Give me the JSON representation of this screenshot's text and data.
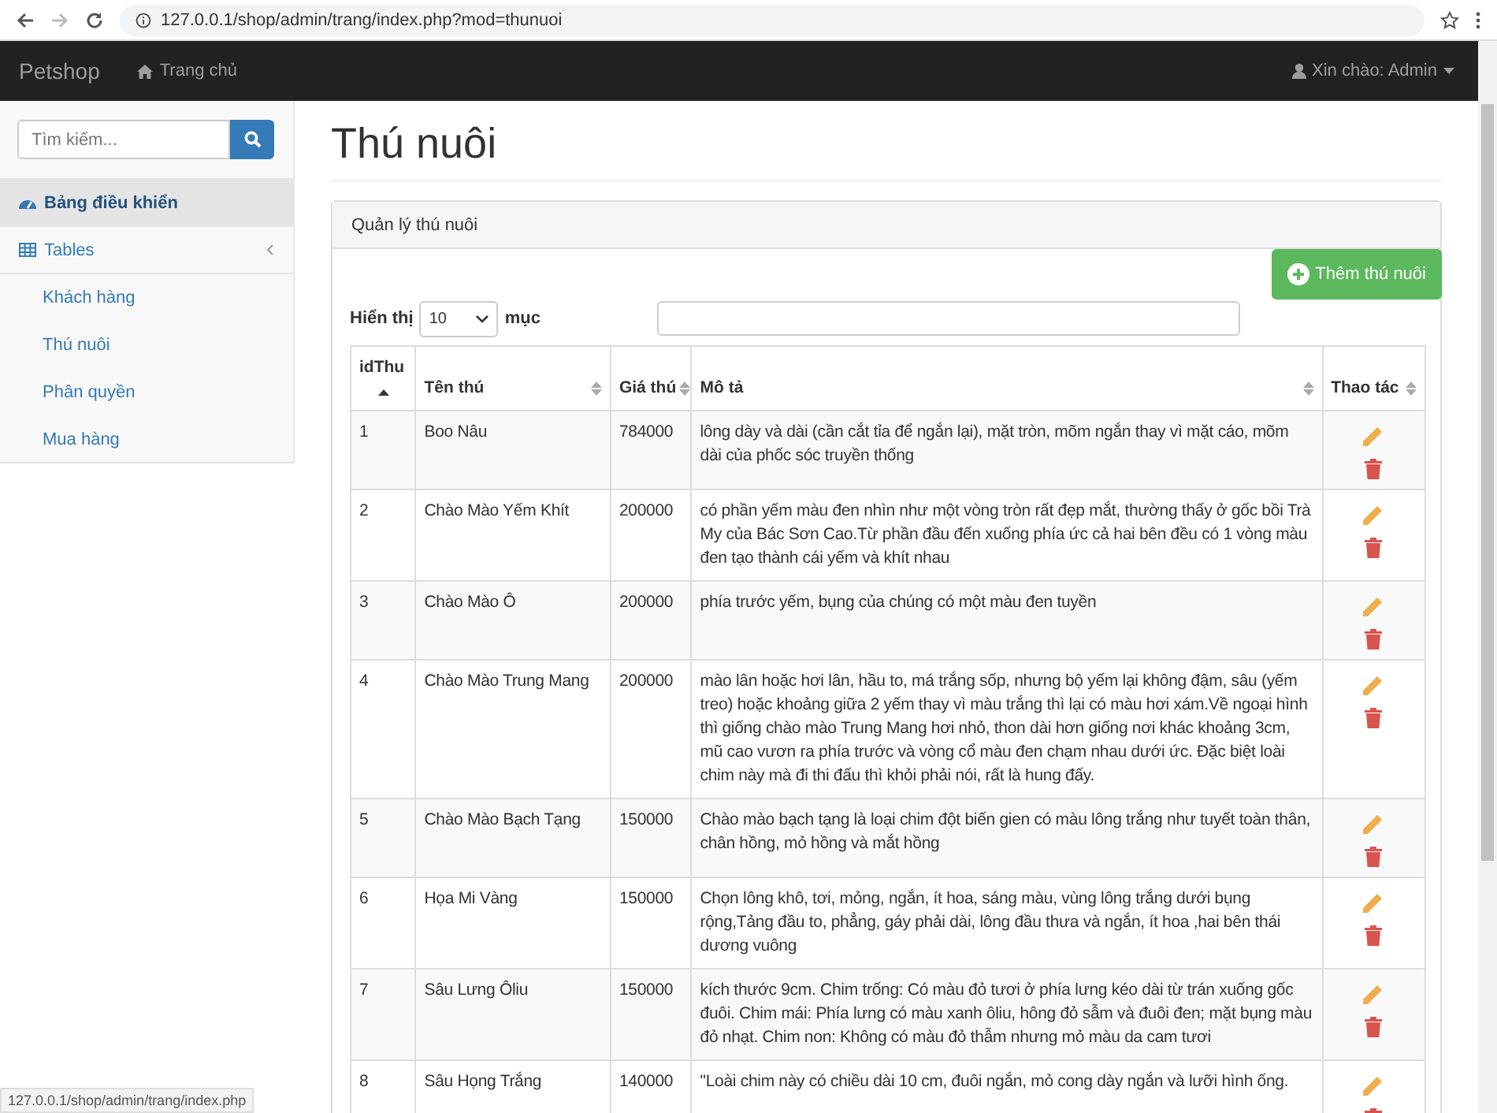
{
  "browser": {
    "url": "127.0.0.1/shop/admin/trang/index.php?mod=thunuoi",
    "status_url": "127.0.0.1/shop/admin/trang/index.php"
  },
  "navbar": {
    "brand": "Petshop",
    "home": "Trang chủ",
    "user": "Xin chào: Admin"
  },
  "sidebar": {
    "search_placeholder": "Tìm kiếm...",
    "items": [
      {
        "label": "Bảng điều khiển",
        "selected": true
      },
      {
        "label": "Tables",
        "selected": false,
        "children": [
          {
            "label": "Khách hàng",
            "selected": false
          },
          {
            "label": "Thú nuôi",
            "selected": false
          },
          {
            "label": "Phân quyền",
            "selected": false
          },
          {
            "label": "Mua hàng",
            "selected": false
          }
        ]
      }
    ]
  },
  "page": {
    "title": "Thú nuôi",
    "panel_title": "Quản lý thú nuôi",
    "add_button": "Thêm thú nuôi",
    "show_label": "Hiển thị",
    "page_size": "10",
    "entries_label": "mục"
  },
  "table": {
    "columns": [
      {
        "label": "idThu",
        "sorted": true
      },
      {
        "label": "Tên thú",
        "sorted": false
      },
      {
        "label": "Giá thú",
        "sorted": false
      },
      {
        "label": "Mô tả",
        "sorted": false
      },
      {
        "label": "Thao tác",
        "sorted": false
      }
    ],
    "rows": [
      {
        "id": "1",
        "name": "Boo Nâu",
        "price": "784000",
        "description": "lông dày và dài (cần cắt tỉa để ngắn lại), mặt tròn, mõm ngắn thay vì mặt cáo, mõm dài của phốc sóc truyền thống"
      },
      {
        "id": "2",
        "name": "Chào Mào Yếm Khít",
        "price": "200000",
        "description": "có phần yếm màu đen nhìn như một vòng tròn rất đẹp mắt, thường thấy ở gốc bồi Trà My của Bác Sơn Cao.Từ phần đầu đến xuống phía ức cả hai bên đều có 1 vòng màu đen tạo thành cái yếm và khít nhau"
      },
      {
        "id": "3",
        "name": "Chào Mào Ô",
        "price": "200000",
        "description": "phía trước yếm, bụng của chúng có một màu đen tuyền"
      },
      {
        "id": "4",
        "name": "Chào Mào Trung Mang",
        "price": "200000",
        "description": "mào lân hoặc hơi lân, hầu to, má trắng sốp, nhưng bộ yếm lại không đậm, sâu (yếm treo) hoặc khoảng giữa 2 yếm thay vì màu trắng thì lại có màu hơi xám.Về ngoại hình thì giống chào mào Trung Mang hơi nhỏ, thon dài hơn giống nơi khác khoảng 3cm, mũ cao vươn ra phía trước và vòng cổ màu đen chạm nhau dưới ức. Đặc biệt loài chim này mà đi thi đấu thì khỏi phải nói, rất là hung đấy."
      },
      {
        "id": "5",
        "name": "Chào Mào Bạch Tạng",
        "price": "150000",
        "description": "Chào mào bạch tạng là loại chim đột biến gien có màu lông trắng như tuyết toàn thân, chân hồng, mỏ hồng và mắt hồng"
      },
      {
        "id": "6",
        "name": "Họa Mi Vàng",
        "price": "150000",
        "description": "Chọn lông khô, tơi, mỏng, ngắn, ít hoa, sáng màu, vùng lông trắng dưới bụng rộng,Tảng đầu to, phẳng, gáy phải dài, lông đầu thưa và ngắn, ít hoa ,hai bên thái dương vuông"
      },
      {
        "id": "7",
        "name": "Sâu Lưng Ôliu",
        "price": "150000",
        "description": "kích thước 9cm. Chim trống: Có màu đỏ tươi ở phía lưng kéo dài từ trán xuống gốc đuôi. Chim mái: Phía lưng có màu xanh ôliu, hông đỏ sẫm và đuôi đen; mặt bụng màu đỏ nhạt. Chim non: Không có màu đỏ thẫm nhưng mỏ màu da cam tươi"
      },
      {
        "id": "8",
        "name": "Sâu Họng Trắng",
        "price": "140000",
        "description": "\"Loài chim này có chiều dài 10 cm, đuôi ngắn, mỏ cong dày ngắn và lưỡi hình ống."
      }
    ]
  }
}
